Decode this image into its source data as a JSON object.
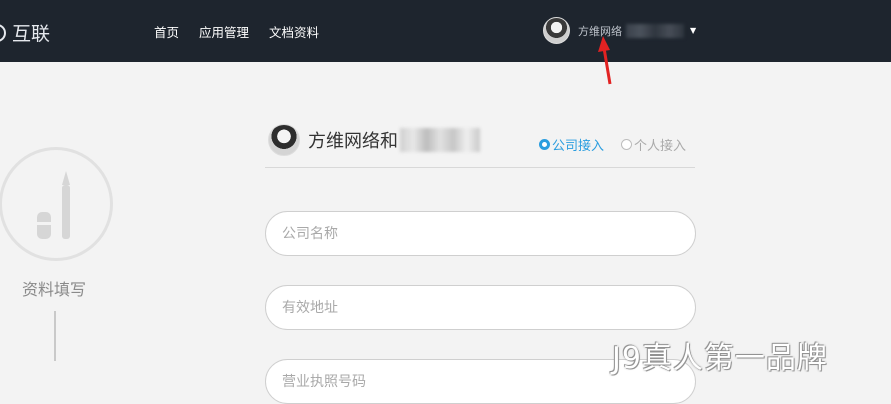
{
  "header": {
    "brand": "互联",
    "nav": [
      "首页",
      "应用管理",
      "文档资料"
    ],
    "user_name": "方维网络"
  },
  "steps": {
    "current_label": "资料填写"
  },
  "form": {
    "company_name": "方维网络和",
    "options": {
      "company": "公司接入",
      "personal": "个人接入",
      "selected": "company"
    },
    "fields": [
      {
        "placeholder": "公司名称"
      },
      {
        "placeholder": "有效地址"
      },
      {
        "placeholder": "营业执照号码"
      }
    ]
  },
  "watermark": "J9真人第一品牌",
  "colors": {
    "topbar": "#1e252e",
    "accent": "#2a9ddf",
    "arrow": "#e22222"
  }
}
